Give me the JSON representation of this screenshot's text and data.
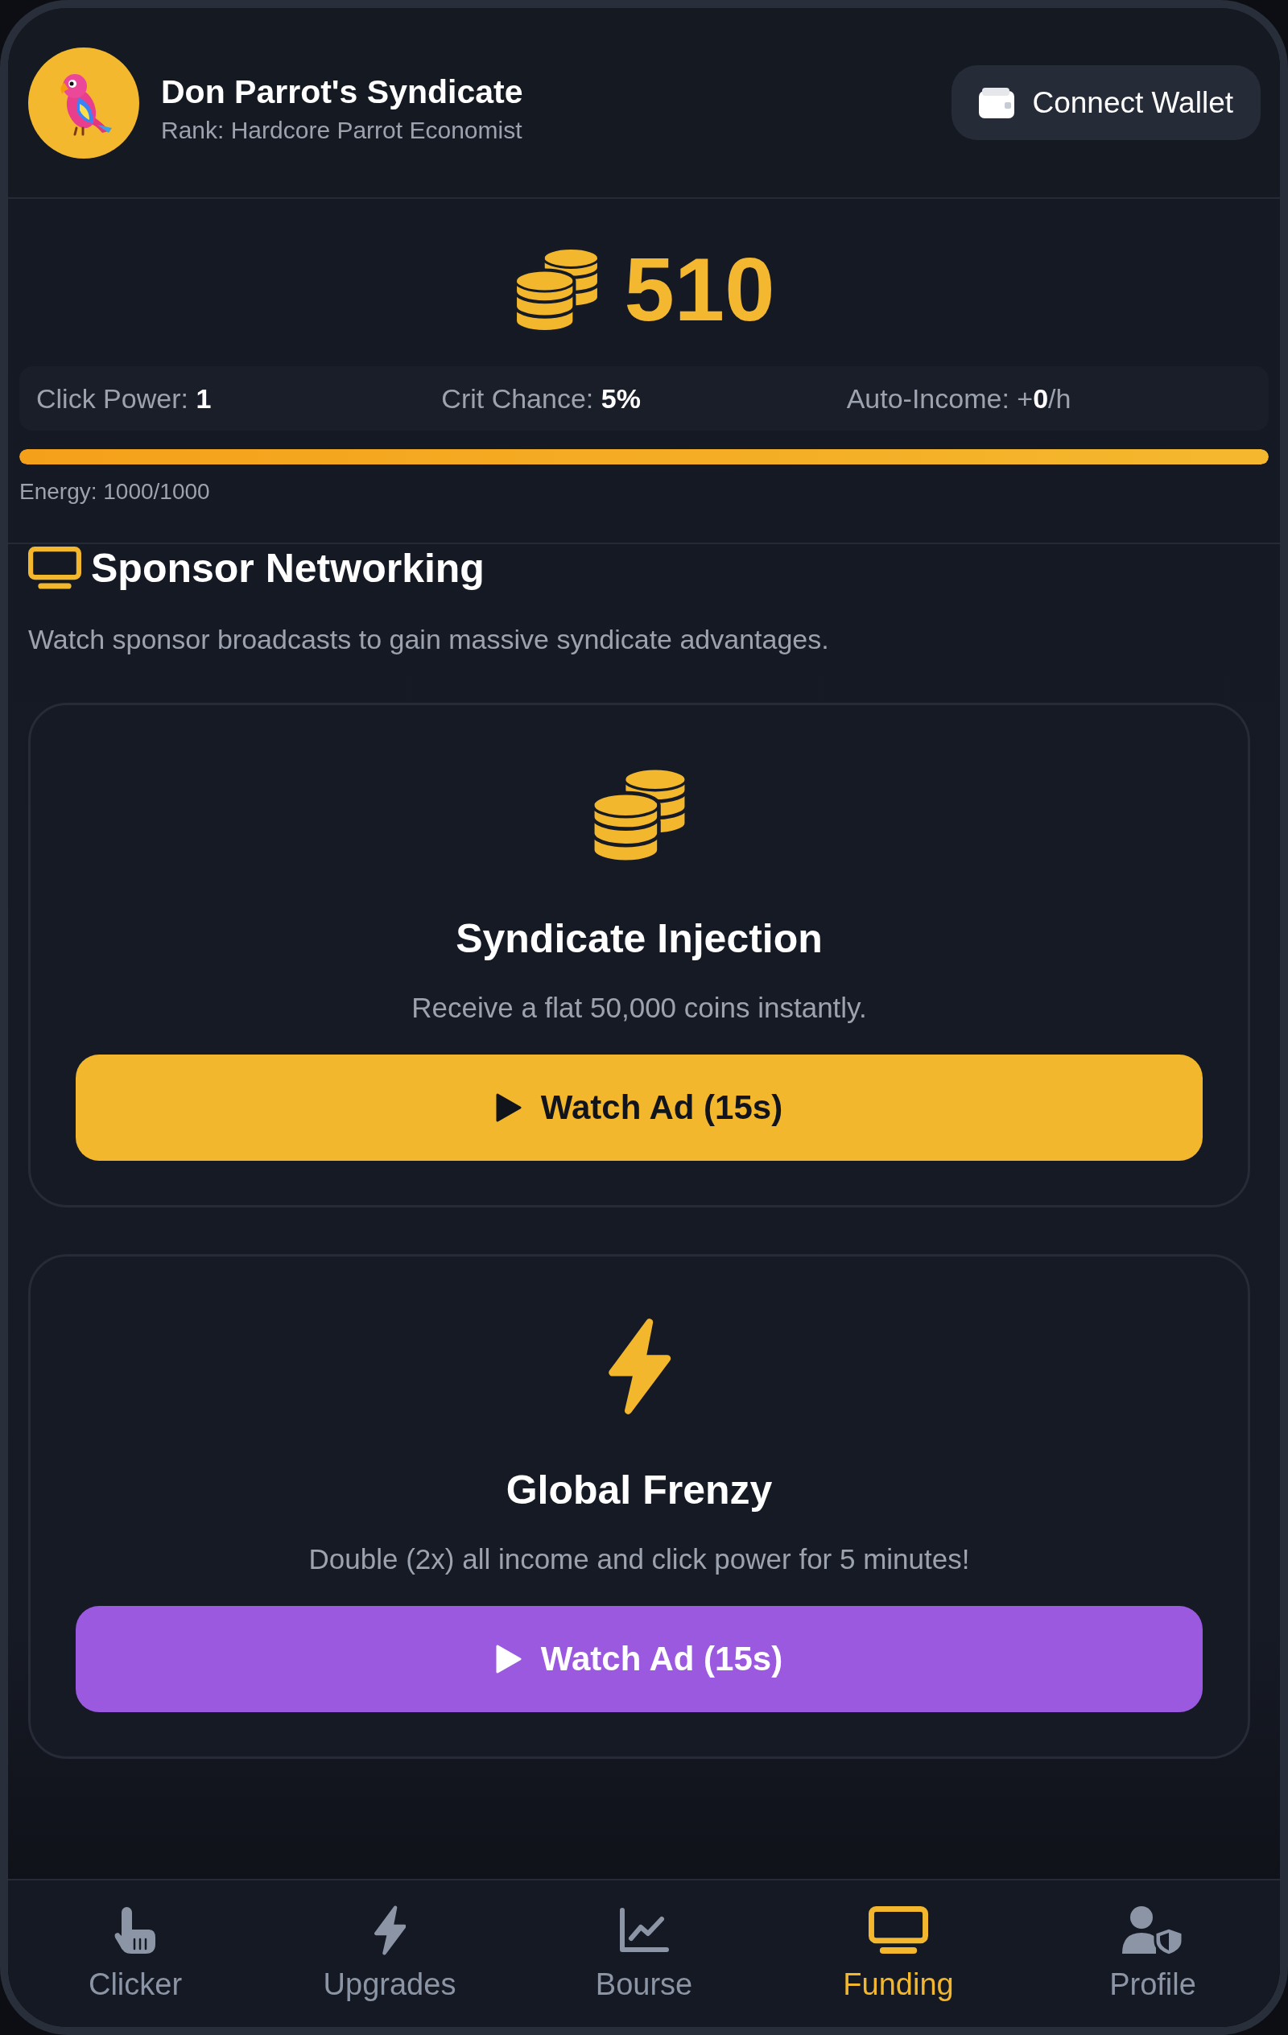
{
  "header": {
    "title": "Don Parrot's Syndicate",
    "subtitle": "Rank: Hardcore Parrot Economist",
    "wallet_button": "Connect Wallet"
  },
  "balance": {
    "amount": "510"
  },
  "stats": [
    {
      "text": "Click Power: **1**"
    },
    {
      "text": "Crit Chance: **5%**"
    },
    {
      "text": "Auto-Income: +**0**/h"
    }
  ],
  "energy": {
    "level": 1,
    "label": "Energy: 1000/1000"
  },
  "section": {
    "title": "Sponsor Networking",
    "description": "Watch sponsor broadcasts to gain massive syndicate advantages."
  },
  "offers": [
    {
      "kind": "coins",
      "title": "Syndicate Injection",
      "description": "Receive a flat 50,000 coins instantly.",
      "button": "Watch Ad (15s)",
      "color": "#f3b72d"
    },
    {
      "kind": "bolt",
      "title": "Global Frenzy",
      "description": "Double (2x) all income and click power for 5 minutes!",
      "button": "Watch Ad (15s)",
      "color": "#9b59e0"
    }
  ],
  "nav": [
    {
      "label": "Clicker",
      "selected": false
    },
    {
      "label": "Upgrades",
      "selected": false
    },
    {
      "label": "Bourse",
      "selected": false
    },
    {
      "label": "Funding",
      "selected": true
    },
    {
      "label": "Profile",
      "selected": false
    }
  ]
}
